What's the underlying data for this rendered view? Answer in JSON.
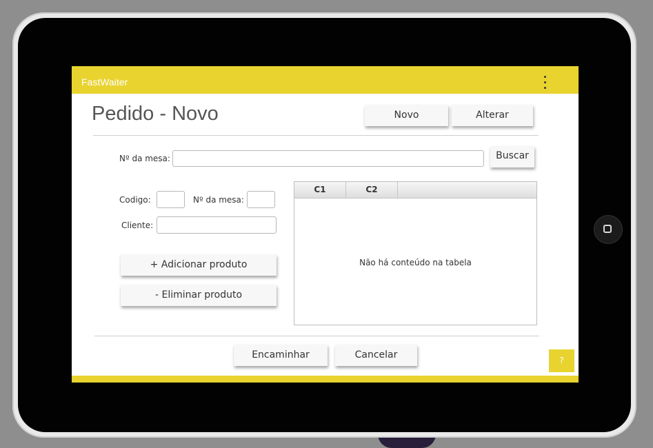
{
  "app": {
    "title": "FastWaiter",
    "menu_icon": "more-vert-icon"
  },
  "page": {
    "title": "Pedido - Novo"
  },
  "header_buttons": {
    "novo": "Novo",
    "alterar": "Alterar"
  },
  "search": {
    "mesa_label": "Nº da mesa:",
    "mesa_value": "",
    "buscar": "Buscar"
  },
  "form": {
    "codigo_label": "Codigo:",
    "codigo_value": "",
    "mesa_label": "Nº da mesa:",
    "mesa_value": "",
    "cliente_label": "Cliente:",
    "cliente_value": ""
  },
  "actions": {
    "adicionar": "+ Adicionar produto",
    "eliminar": "- Eliminar produto"
  },
  "table": {
    "columns": [
      "C1",
      "C2"
    ],
    "empty_message": "Não há conteúdo na tabela"
  },
  "footer": {
    "encaminhar": "Encaminhar",
    "cancelar": "Cancelar",
    "help": "?"
  },
  "colors": {
    "accent": "#e8d32f",
    "tablet_frame": "#e9e9e9",
    "tablet_bezel": "#020202"
  }
}
